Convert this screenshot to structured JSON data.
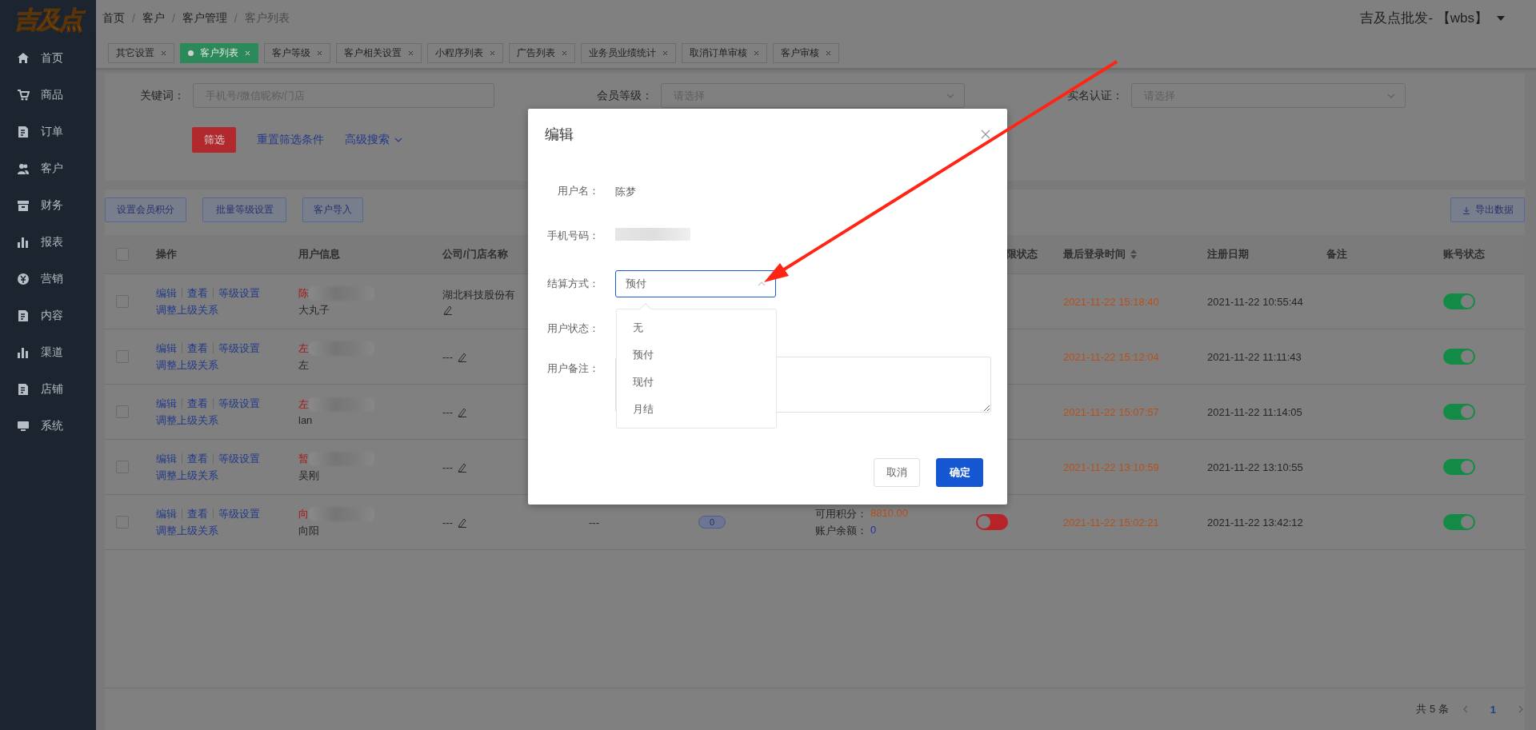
{
  "logo": "吉及点",
  "sidebar": {
    "items": [
      {
        "label": "首页",
        "kind": "home"
      },
      {
        "label": "商品",
        "kind": "cart"
      },
      {
        "label": "订单",
        "kind": "doc"
      },
      {
        "label": "客户",
        "kind": "users"
      },
      {
        "label": "财务",
        "kind": "box"
      },
      {
        "label": "报表",
        "kind": "bars"
      },
      {
        "label": "营销",
        "kind": "coin"
      },
      {
        "label": "内容",
        "kind": "doc"
      },
      {
        "label": "渠道",
        "kind": "bars"
      },
      {
        "label": "店铺",
        "kind": "doc"
      },
      {
        "label": "系统",
        "kind": "monitor"
      }
    ]
  },
  "breadcrumb": [
    {
      "kind": "link",
      "text": "首页"
    },
    {
      "kind": "separator",
      "text": "/"
    },
    {
      "kind": "link",
      "text": "客户"
    },
    {
      "kind": "separator",
      "text": "/"
    },
    {
      "kind": "link",
      "text": "客户管理"
    },
    {
      "kind": "separator",
      "text": "/"
    },
    {
      "kind": "current",
      "text": "客户列表"
    }
  ],
  "user_menu": {
    "label": "吉及点批发- 【wbs】"
  },
  "tabs": [
    {
      "label": "其它设置",
      "selected": false
    },
    {
      "label": "客户列表",
      "selected": true
    },
    {
      "label": "客户等级",
      "selected": false
    },
    {
      "label": "客户相关设置",
      "selected": false
    },
    {
      "label": "小程序列表",
      "selected": false
    },
    {
      "label": "广告列表",
      "selected": false
    },
    {
      "label": "业务员业绩统计",
      "selected": false
    },
    {
      "label": "取消订单审核",
      "selected": false
    },
    {
      "label": "客户审核",
      "selected": false
    }
  ],
  "filters": [
    {
      "kind": "text",
      "label": "关键词：",
      "placeholder": "手机号/微信昵称/门店"
    },
    {
      "kind": "select",
      "label": "会员等级：",
      "placeholder": "请选择"
    },
    {
      "kind": "select",
      "label": "实名认证：",
      "placeholder": "请选择"
    }
  ],
  "filter_actions": [
    {
      "kind": "primary",
      "label": "筛选"
    },
    {
      "kind": "link",
      "label": "重置筛选条件"
    },
    {
      "kind": "dropdown",
      "label": "高级搜索"
    }
  ],
  "toolbar": {
    "buttons": [
      "设置会员积分",
      "批量等级设置",
      "客户导入"
    ],
    "export": "导出数据"
  },
  "table": {
    "select_all_checked": false,
    "columns": {
      "actions": "操作",
      "user_info": "用户信息",
      "company": "公司/门店名称",
      "column_8": "限状态",
      "last_login": "最后登录时间",
      "registered": "注册日期",
      "remarks": "备注",
      "account_status": "账号状态"
    },
    "rows": [
      {
        "actions": [
          "编辑",
          "查看",
          "等级设置",
          "调整上级关系"
        ],
        "checked": false,
        "name": "陈",
        "nickname": "大丸子",
        "company": "湖北科技股份有",
        "account_enabled": true,
        "last_login": "2021-11-22 15:18:40",
        "registered": "2021-11-22 10:55:44"
      },
      {
        "actions": [
          "编辑",
          "查看",
          "等级设置",
          "调整上级关系"
        ],
        "checked": false,
        "name": "左",
        "nickname": "左",
        "company": "---",
        "account_enabled": true,
        "last_login": "2021-11-22 15:12:04",
        "registered": "2021-11-22 11:11:43"
      },
      {
        "actions": [
          "编辑",
          "查看",
          "等级设置",
          "调整上级关系"
        ],
        "checked": false,
        "name": "左",
        "nickname": "lan",
        "company": "---",
        "account_enabled": true,
        "last_login": "2021-11-22 15:07:57",
        "registered": "2021-11-22 11:14:05"
      },
      {
        "actions": [
          "编辑",
          "查看",
          "等级设置",
          "调整上级关系"
        ],
        "checked": false,
        "name": "暂",
        "nickname": "吴刚",
        "company": "---",
        "account_enabled": true,
        "last_login": "2021-11-22 13:10:59",
        "registered": "2021-11-22 13:10:55"
      },
      {
        "actions": [
          "编辑",
          "查看",
          "等级设置",
          "调整上级关系"
        ],
        "checked": false,
        "name": "向",
        "nickname": "向阳",
        "company": "---",
        "column_5": "---",
        "column_6": "0",
        "points_label": "可用积分：",
        "points": "8810.00",
        "balance_label": "账户余额：",
        "balance": "0",
        "column_8_on": false,
        "account_enabled": true,
        "last_login": "2021-11-22 15:02:21",
        "registered": "2021-11-22 13:42:12"
      }
    ]
  },
  "pagination": {
    "total": "共 5 条",
    "pages": [
      {
        "label": "1",
        "selected": true
      }
    ]
  },
  "modal": {
    "title": "编辑",
    "fields": [
      {
        "kind": "text",
        "label": "用户名：",
        "value": "陈梦"
      },
      {
        "kind": "redacted",
        "label": "手机号码："
      },
      {
        "kind": "select",
        "label": "结算方式：",
        "value": "预付",
        "expanded": true,
        "options": [
          "无",
          "预付",
          "现付",
          "月结"
        ]
      },
      {
        "kind": "label_only",
        "label": "用户状态："
      },
      {
        "kind": "textarea",
        "label": "用户备注："
      }
    ],
    "buttons": [
      {
        "kind": "default",
        "label": "取消"
      },
      {
        "kind": "primary",
        "label": "确定"
      }
    ]
  }
}
